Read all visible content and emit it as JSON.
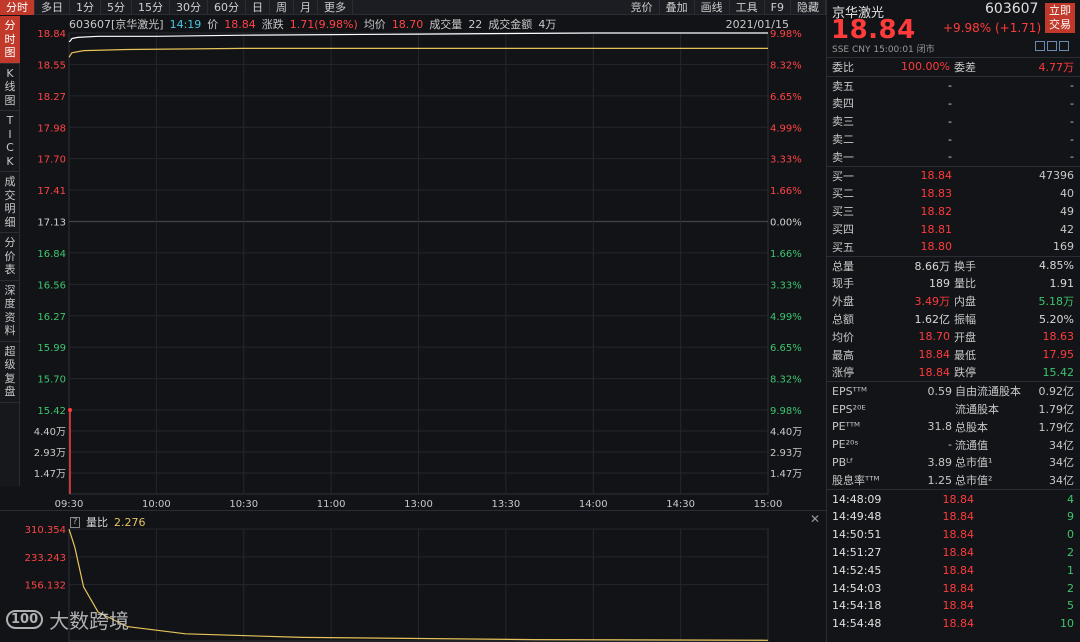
{
  "toolbar": {
    "left": [
      "分时",
      "多日",
      "1分",
      "5分",
      "15分",
      "30分",
      "60分",
      "日",
      "周",
      "月",
      "更多"
    ],
    "right": [
      "竞价",
      "叠加",
      "画线",
      "工具",
      "F9",
      "隐藏"
    ]
  },
  "sidebar": [
    "分\n时\n图",
    "K\n线\n图",
    "T\nI\nC\nK",
    "成\n交\n明\n细",
    "分\n价\n表",
    "深\n度\n资\n料",
    "超\n级\n复\n盘"
  ],
  "infobar": {
    "code_name": "603607[京华激光]",
    "time": "14:19",
    "price_label": "价",
    "price": "18.84",
    "change_label": "涨跌",
    "change": "1.71(9.98%)",
    "avg_label": "均价",
    "avg": "18.70",
    "vol_label": "成交量",
    "vol": "22",
    "amount_label": "成交金额",
    "amount": "4万",
    "date": "2021/01/15"
  },
  "chart_data": {
    "type": "line",
    "price_ticks": [
      "18.84",
      "18.55",
      "18.27",
      "17.98",
      "17.70",
      "17.41",
      "17.13",
      "16.84",
      "16.56",
      "16.27",
      "15.99",
      "15.70",
      "15.42"
    ],
    "pct_ticks": [
      "9.98%",
      "8.32%",
      "6.65%",
      "4.99%",
      "3.33%",
      "1.66%",
      "0.00%",
      "1.66%",
      "3.33%",
      "4.99%",
      "6.65%",
      "8.32%",
      "9.98%"
    ],
    "vol_ticks": [
      "4.40万",
      "2.93万",
      "1.47万"
    ],
    "time_ticks": [
      "09:30",
      "10:00",
      "10:30",
      "11:00",
      "13:00",
      "13:30",
      "14:00",
      "14:30",
      "15:00"
    ],
    "prev_close": 17.13,
    "ylim": [
      15.42,
      18.84
    ],
    "price_series": [
      [
        0,
        18.76
      ],
      [
        0.5,
        18.77
      ],
      [
        1,
        18.79
      ],
      [
        3,
        18.8
      ],
      [
        10,
        18.81
      ],
      [
        30,
        18.81
      ],
      [
        60,
        18.82
      ],
      [
        120,
        18.83
      ],
      [
        180,
        18.84
      ],
      [
        240,
        18.84
      ]
    ],
    "avg_series": [
      [
        0,
        18.62
      ],
      [
        1,
        18.66
      ],
      [
        5,
        18.68
      ],
      [
        20,
        18.69
      ],
      [
        60,
        18.7
      ],
      [
        240,
        18.7
      ]
    ],
    "volume_spike": 4.4,
    "ratio_label": "量比",
    "ratio_value": "2.276",
    "ratio_ticks": [
      "310.354",
      "233.243",
      "156.132"
    ],
    "ratio_series": [
      [
        0,
        310
      ],
      [
        2,
        260
      ],
      [
        5,
        150
      ],
      [
        10,
        80
      ],
      [
        20,
        40
      ],
      [
        40,
        20
      ],
      [
        80,
        10
      ],
      [
        160,
        4
      ],
      [
        240,
        2
      ]
    ]
  },
  "watermark": {
    "logo": "100",
    "text": "大数跨境"
  },
  "quote": {
    "name": "京华激光",
    "code": "603607",
    "price": "18.84",
    "change": "+9.98% (+1.71)",
    "trade_btn": "立即\n交易",
    "meta": "SSE  CNY  15:00:01  闭市",
    "weibi": {
      "label": "委比",
      "value": "100.00%",
      "label2": "委差",
      "value2": "4.77万"
    },
    "asks": [
      {
        "label": "卖五",
        "price": "-",
        "vol": "-"
      },
      {
        "label": "卖四",
        "price": "-",
        "vol": "-"
      },
      {
        "label": "卖三",
        "price": "-",
        "vol": "-"
      },
      {
        "label": "卖二",
        "price": "-",
        "vol": "-"
      },
      {
        "label": "卖一",
        "price": "-",
        "vol": "-"
      }
    ],
    "bids": [
      {
        "label": "买一",
        "price": "18.84",
        "vol": "47396"
      },
      {
        "label": "买二",
        "price": "18.83",
        "vol": "40"
      },
      {
        "label": "买三",
        "price": "18.82",
        "vol": "49"
      },
      {
        "label": "买四",
        "price": "18.81",
        "vol": "42"
      },
      {
        "label": "买五",
        "price": "18.80",
        "vol": "169"
      }
    ],
    "stats": [
      {
        "a": "总量",
        "b": "8.66万",
        "bc": "wh",
        "c": "换手",
        "d": "4.85%",
        "dc": "wh"
      },
      {
        "a": "现手",
        "b": "189",
        "bc": "wh",
        "c": "量比",
        "d": "1.91",
        "dc": "wh"
      },
      {
        "a": "外盘",
        "b": "3.49万",
        "bc": "red",
        "c": "内盘",
        "d": "5.18万",
        "dc": "green"
      },
      {
        "a": "总额",
        "b": "1.62亿",
        "bc": "wh",
        "c": "振幅",
        "d": "5.20%",
        "dc": "wh"
      },
      {
        "a": "均价",
        "b": "18.70",
        "bc": "red",
        "c": "开盘",
        "d": "18.63",
        "dc": "red"
      },
      {
        "a": "最高",
        "b": "18.84",
        "bc": "red",
        "c": "最低",
        "d": "17.95",
        "dc": "red"
      },
      {
        "a": "涨停",
        "b": "18.84",
        "bc": "red",
        "c": "跌停",
        "d": "15.42",
        "dc": "green"
      }
    ],
    "fin": [
      {
        "a": "EPSᵀᵀᴹ",
        "b": "0.59",
        "c": "自由流通股本",
        "d": "0.92亿"
      },
      {
        "a": "EPS²⁰ᴱ",
        "b": "",
        "c": "流通股本",
        "d": "1.79亿"
      },
      {
        "a": "PEᵀᵀᴹ",
        "b": "31.8",
        "c": "总股本",
        "d": "1.79亿"
      },
      {
        "a": "PE²⁰ˢ",
        "b": "-",
        "c": "流通值",
        "d": "34亿"
      },
      {
        "a": "PBᴸᶠ",
        "b": "3.89",
        "c": "总市值¹",
        "d": "34亿"
      },
      {
        "a": "股息率ᵀᵀᴹ",
        "b": "1.25",
        "c": "总市值²",
        "d": "34亿"
      }
    ],
    "ticks": [
      {
        "t": "14:48:09",
        "p": "18.84",
        "v": "4"
      },
      {
        "t": "14:49:48",
        "p": "18.84",
        "v": "9"
      },
      {
        "t": "14:50:51",
        "p": "18.84",
        "v": "0"
      },
      {
        "t": "14:51:27",
        "p": "18.84",
        "v": "2"
      },
      {
        "t": "14:52:45",
        "p": "18.84",
        "v": "1"
      },
      {
        "t": "14:54:03",
        "p": "18.84",
        "v": "2"
      },
      {
        "t": "14:54:18",
        "p": "18.84",
        "v": "5"
      },
      {
        "t": "14:54:48",
        "p": "18.84",
        "v": "10"
      }
    ]
  }
}
